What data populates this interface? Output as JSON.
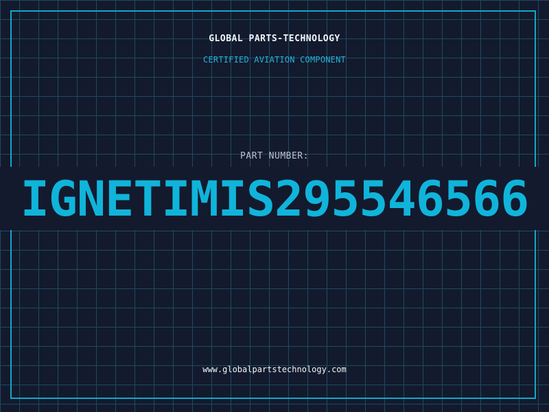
{
  "header": {
    "company_name": "GLOBAL PARTS-TECHNOLOGY",
    "tagline": "CERTIFIED AVIATION COMPONENT"
  },
  "part": {
    "label": "PART NUMBER:",
    "number": "IGNETIMIS295546566"
  },
  "footer": {
    "website": "www.globalpartstechnology.com"
  },
  "colors": {
    "background": "#131a2d",
    "grid": "#1e4a63",
    "accent": "#14a7c9",
    "part_number": "#10b4da",
    "text_light": "#f2f4f7",
    "text_muted": "#b9c0cc"
  }
}
